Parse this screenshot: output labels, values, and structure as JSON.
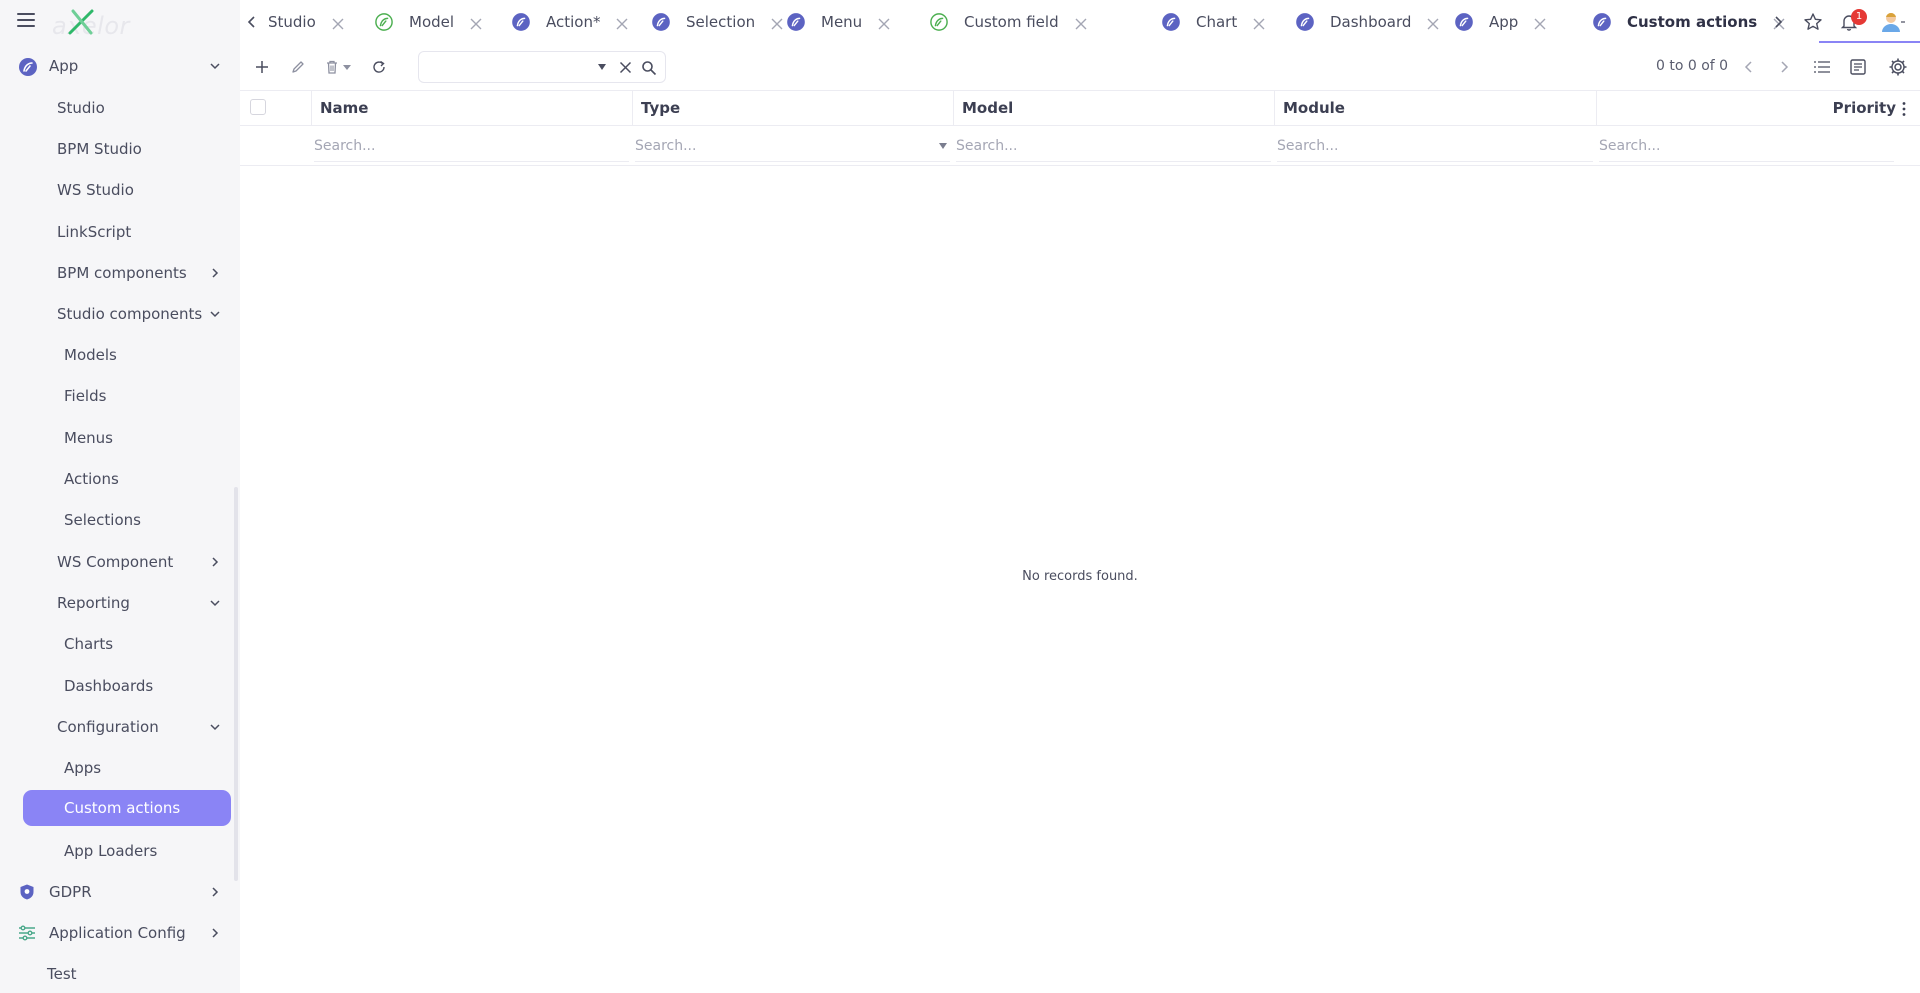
{
  "brand": {
    "logo_text": "axelor"
  },
  "sidebar": {
    "items": [
      {
        "label": "App",
        "level": 0,
        "icon": "app-logo-icon",
        "chevron": "down"
      },
      {
        "label": "Studio",
        "level": 1
      },
      {
        "label": "BPM Studio",
        "level": 1
      },
      {
        "label": "WS Studio",
        "level": 1
      },
      {
        "label": "LinkScript",
        "level": 1
      },
      {
        "label": "BPM components",
        "level": 1,
        "chevron": "right"
      },
      {
        "label": "Studio components",
        "level": 1,
        "chevron": "down"
      },
      {
        "label": "Models",
        "level": 2
      },
      {
        "label": "Fields",
        "level": 2
      },
      {
        "label": "Menus",
        "level": 2
      },
      {
        "label": "Actions",
        "level": 2
      },
      {
        "label": "Selections",
        "level": 2
      },
      {
        "label": "WS Component",
        "level": 1,
        "chevron": "right"
      },
      {
        "label": "Reporting",
        "level": 1,
        "chevron": "down"
      },
      {
        "label": "Charts",
        "level": 2
      },
      {
        "label": "Dashboards",
        "level": 2
      },
      {
        "label": "Configuration",
        "level": 1,
        "chevron": "down"
      },
      {
        "label": "Apps",
        "level": 2
      },
      {
        "label": "Custom actions",
        "level": 2,
        "active": true
      },
      {
        "label": "App Loaders",
        "level": 2
      },
      {
        "label": "GDPR",
        "level": 0,
        "icon": "shield-icon",
        "chevron": "right"
      },
      {
        "label": "Application Config",
        "level": 0,
        "icon": "sliders-icon",
        "chevron": "right"
      },
      {
        "label": "Test",
        "level": 0
      }
    ]
  },
  "tabs": [
    {
      "label": "Studio",
      "icon": "none"
    },
    {
      "label": "Model",
      "icon": "green"
    },
    {
      "label": "Action*",
      "icon": "blue"
    },
    {
      "label": "Selection",
      "icon": "blue"
    },
    {
      "label": "Menu",
      "icon": "blue"
    },
    {
      "label": "Custom field",
      "icon": "green"
    },
    {
      "label": "Chart",
      "icon": "blue"
    },
    {
      "label": "Dashboard",
      "icon": "blue"
    },
    {
      "label": "App",
      "icon": "blue"
    },
    {
      "label": "Custom actions",
      "icon": "blue",
      "active": true
    }
  ],
  "notifications": {
    "count": "1"
  },
  "toolbar": {
    "search_value": "",
    "pager": "0 to 0 of 0"
  },
  "grid": {
    "columns": [
      {
        "label": "Name",
        "placeholder": "Search..."
      },
      {
        "label": "Type",
        "placeholder": "Search..."
      },
      {
        "label": "Model",
        "placeholder": "Search..."
      },
      {
        "label": "Module",
        "placeholder": "Search..."
      },
      {
        "label": "Priority",
        "placeholder": "Search..."
      }
    ],
    "empty_message": "No records found."
  },
  "colors": {
    "accent": "#8a84f5",
    "icon_blue": "#5c63c2",
    "icon_green": "#4caf50",
    "badge_red": "#e53935"
  }
}
